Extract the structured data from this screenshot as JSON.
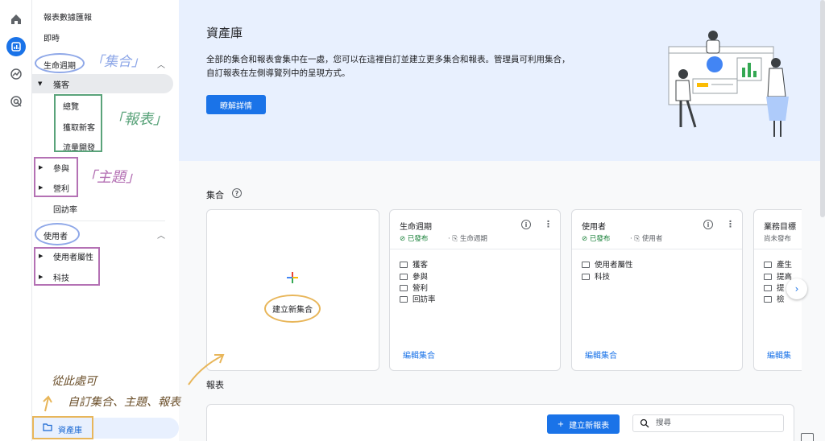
{
  "sidebar": {
    "top_items": [
      "報表數據匯報",
      "即時"
    ],
    "lifecycle_section": "生命週期",
    "acquisition_topic": "獲客",
    "acquisition_reports": [
      "總覽",
      "獲取新客",
      "流量開發"
    ],
    "other_topics": [
      "參與",
      "營利"
    ],
    "retention_item": "回訪率",
    "users_section": "使用者",
    "users_topics": [
      "使用者屬性",
      "科技"
    ],
    "library_label": "資產庫"
  },
  "annotations": {
    "collection": "「集合」",
    "report": "「報表」",
    "topic": "「主題」",
    "note_line1": "從此處可",
    "note_line2": "自訂集合、主題、報表"
  },
  "hero": {
    "title": "資產庫",
    "description": "全部的集合和報表會集中在一處，您可以在這裡自訂並建立更多集合和報表。管理員可利用集合，自訂報表在左側導覽列中的呈現方式。",
    "button": "瞭解詳情"
  },
  "collections": {
    "title": "集合",
    "new_label": "建立新集合",
    "cards": [
      {
        "title": "生命週期",
        "status": "已發布",
        "meta": "生命週期",
        "items": [
          "獲客",
          "參與",
          "營利",
          "回訪率"
        ],
        "edit": "編輯集合"
      },
      {
        "title": "使用者",
        "status": "已發布",
        "meta": "使用者",
        "items": [
          "使用者屬性",
          "科技"
        ],
        "edit": "編輯集合"
      },
      {
        "title": "業務目標",
        "status": "尚未發布",
        "items": [
          "產生",
          "提高",
          "提",
          "檢"
        ],
        "edit": "編輯集"
      }
    ]
  },
  "reports": {
    "title": "報表",
    "new_button": "建立新報表",
    "search_placeholder": "搜尋"
  },
  "colors": {
    "accent": "#1a73e8",
    "hero_bg": "#e8f0fe",
    "published": "#188038"
  }
}
